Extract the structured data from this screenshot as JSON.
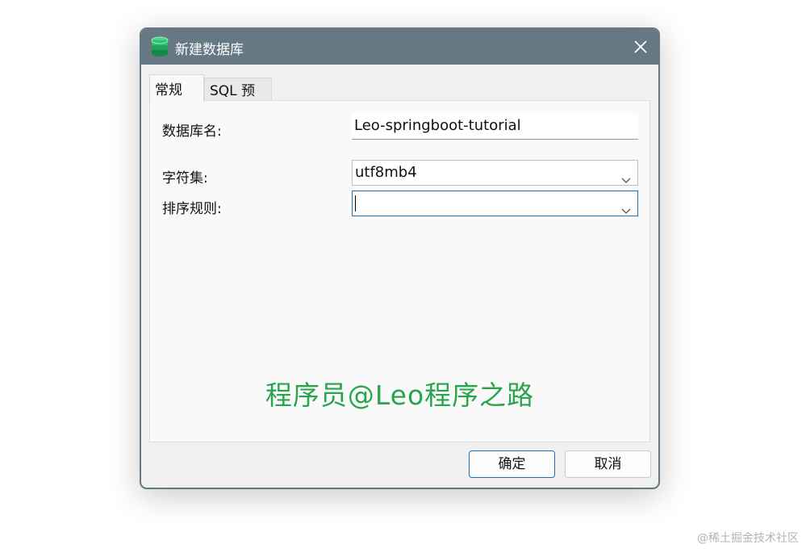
{
  "dialog": {
    "title": "新建数据库",
    "app_icon": "database-icon",
    "close_icon": "close-icon",
    "tabs": [
      {
        "label": "常规",
        "active": true
      },
      {
        "label": "SQL 预览",
        "active": false
      }
    ],
    "fields": {
      "database_name": {
        "label": "数据库名:",
        "value": "Leo-springboot-tutorial"
      },
      "charset": {
        "label": "字符集:",
        "value": "utf8mb4"
      },
      "collation": {
        "label": "排序规则:",
        "value": ""
      }
    },
    "buttons": {
      "ok": "确定",
      "cancel": "取消"
    },
    "accent_color": "#1a6fb5",
    "titlebar_color": "#667884"
  },
  "watermark": "程序员@Leo程序之路",
  "corner_watermark": "@稀土掘金技术社区"
}
